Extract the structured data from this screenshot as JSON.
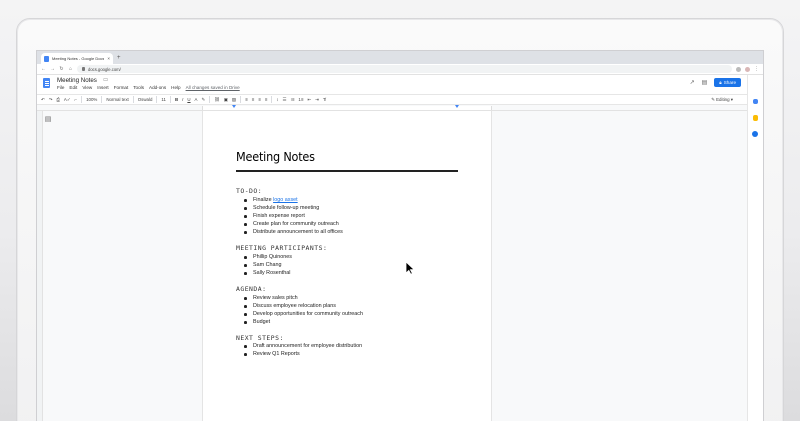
{
  "browser": {
    "tab_title": "Meeting Notes - Google Docs",
    "tab_close": "×",
    "new_tab": "+",
    "url": "docs.google.com/"
  },
  "docs": {
    "title": "Meeting Notes",
    "menu": [
      "File",
      "Edit",
      "View",
      "Insert",
      "Format",
      "Tools",
      "Add-ons",
      "Help"
    ],
    "saved_status": "All changes saved in Drive",
    "share_label": "Share",
    "editing_label": "Editing"
  },
  "toolbar": {
    "zoom": "100%",
    "style": "Normal text",
    "font": "Oswald",
    "size": "11"
  },
  "document": {
    "heading": "Meeting Notes",
    "sections": [
      {
        "title": "TO-DO:",
        "items": [
          {
            "pre": "Finalize ",
            "link": "logo asset"
          },
          {
            "pre": "Schedule follow-up meeting"
          },
          {
            "pre": "Finish expense report"
          },
          {
            "pre": "Create plan for community outreach"
          },
          {
            "pre": "Distribute announcement to all offices"
          }
        ]
      },
      {
        "title": "MEETING PARTICIPANTS:",
        "items": [
          {
            "pre": "Phillip Quinones"
          },
          {
            "pre": "Sam Chang"
          },
          {
            "pre": "Sally Rosenthal"
          }
        ]
      },
      {
        "title": "AGENDA:",
        "items": [
          {
            "pre": "Review sales pitch"
          },
          {
            "pre": "Discuss employee relocation plans"
          },
          {
            "pre": "Develop opportunities for community outreach"
          },
          {
            "pre": "Budget"
          }
        ]
      },
      {
        "title": "NEXT STEPS:",
        "items": [
          {
            "pre": "Draft announcement for employee distribution"
          },
          {
            "pre": "Review Q1 Reports"
          }
        ]
      }
    ]
  },
  "colors": {
    "accent": "#1a73e8",
    "docs_blue": "#4285f4"
  }
}
